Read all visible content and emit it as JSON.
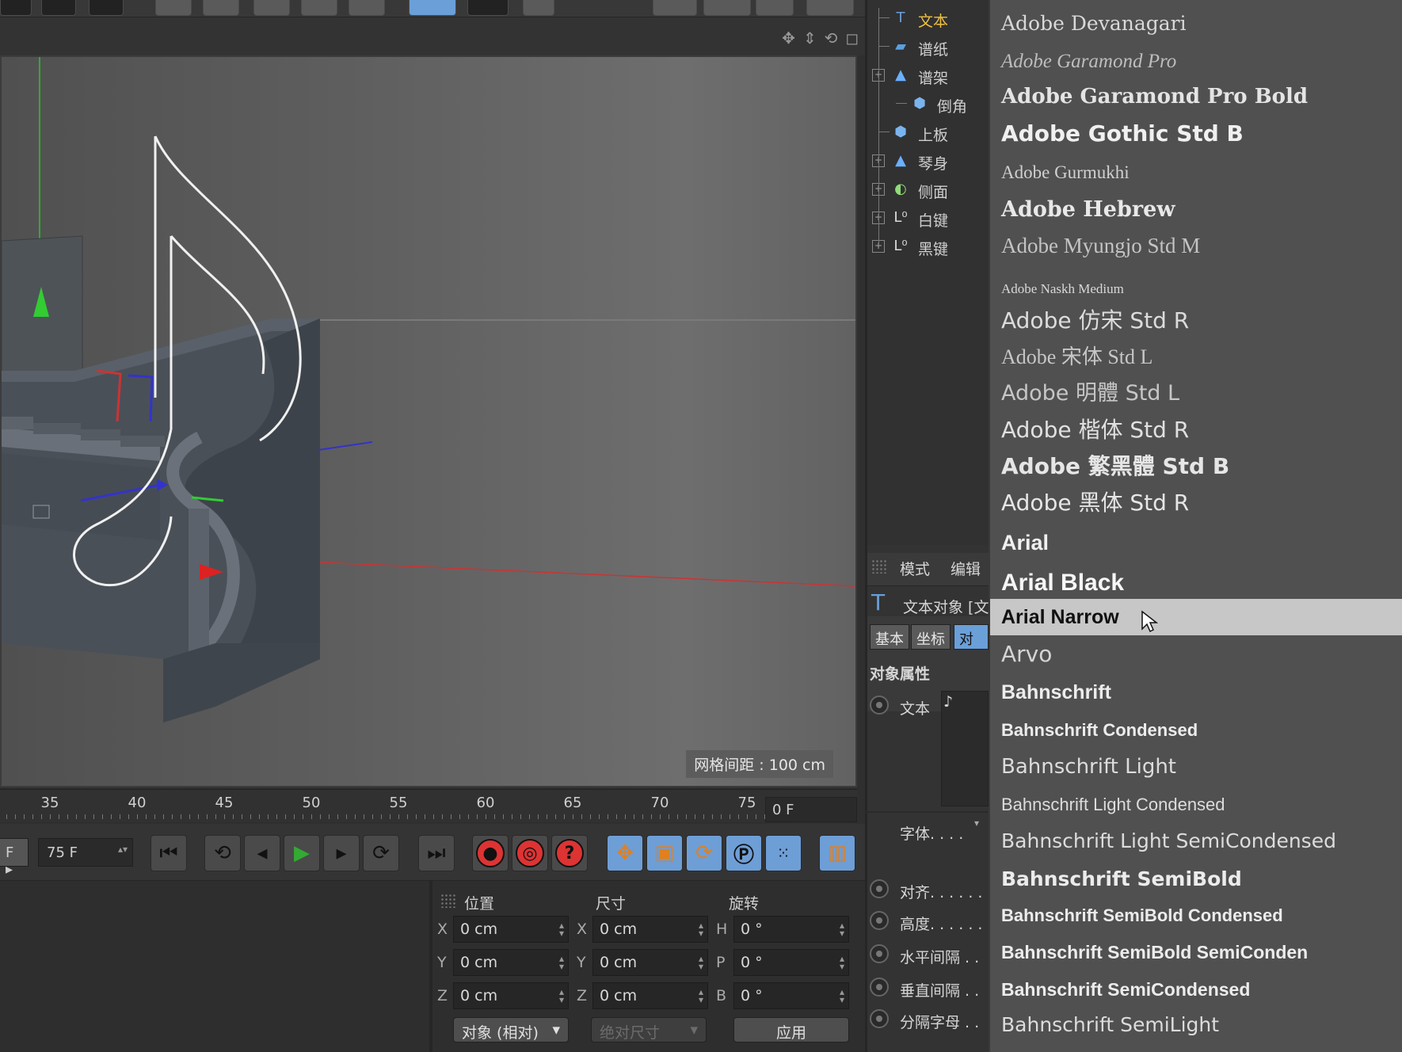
{
  "viewport": {
    "grid_spacing": "网格间距 : 100 cm"
  },
  "timeline": {
    "ticks": [
      "35",
      "40",
      "45",
      "50",
      "55",
      "60",
      "65",
      "70",
      "75"
    ],
    "current_frame": "0 F",
    "end_frame": "75 F"
  },
  "coordinates": {
    "headers": {
      "position": "位置",
      "size": "尺寸",
      "rotation": "旋转"
    },
    "rows": [
      {
        "axis": "X",
        "pos": "0 cm",
        "size_axis": "X",
        "size": "0 cm",
        "rot_axis": "H",
        "rot": "0 °"
      },
      {
        "axis": "Y",
        "pos": "0 cm",
        "size_axis": "Y",
        "size": "0 cm",
        "rot_axis": "P",
        "rot": "0 °"
      },
      {
        "axis": "Z",
        "pos": "0 cm",
        "size_axis": "Z",
        "size": "0 cm",
        "rot_axis": "B",
        "rot": "0 °"
      }
    ],
    "mode_dropdown": "对象 (相对)",
    "size_dropdown": "绝对尺寸",
    "apply_button": "应用"
  },
  "object_manager": {
    "items": [
      {
        "label": "文本",
        "icon": "text-icon",
        "highlight": true
      },
      {
        "label": "谱纸",
        "icon": "plane-icon"
      },
      {
        "label": "谱架",
        "icon": "null-icon"
      },
      {
        "label": "倒角",
        "icon": "cube-icon"
      },
      {
        "label": "上板",
        "icon": "cube-icon"
      },
      {
        "label": "琴身",
        "icon": "null-icon"
      },
      {
        "label": "侧面",
        "icon": "sphere-icon"
      },
      {
        "label": "白键",
        "icon": "cloner-icon"
      },
      {
        "label": "黑键",
        "icon": "cloner-icon"
      }
    ]
  },
  "attributes": {
    "menu": {
      "mode": "模式",
      "edit": "编辑"
    },
    "object_title": "文本对象 [文",
    "tabs": [
      "基本",
      "坐标",
      "对象"
    ],
    "section": "对象属性",
    "text_label": "文本",
    "text_value": "♪",
    "font_label": "字体. . . .",
    "params": [
      "对齐. . . . . .",
      "高度. . . . . .",
      "水平间隔 . .",
      "垂直间隔 . .",
      "分隔字母 . ."
    ]
  },
  "font_list": {
    "selected": "Arial Narrow",
    "items": [
      "Adobe Devanagari",
      "Adobe Garamond Pro",
      "Adobe Garamond Pro Bold",
      "Adobe Gothic Std B",
      "Adobe Gurmukhi",
      "Adobe Hebrew",
      "Adobe Myungjo Std M",
      "Adobe Naskh Medium",
      "Adobe 仿宋 Std R",
      "Adobe 宋体 Std L",
      "Adobe 明體 Std L",
      "Adobe 楷体 Std R",
      "Adobe 繁黑體 Std B",
      "Adobe 黑体 Std R",
      "Arial",
      "Arial Black",
      "Arial Narrow",
      "Arvo",
      "Bahnschrift",
      "Bahnschrift Condensed",
      "Bahnschrift Light",
      "Bahnschrift Light Condensed",
      "Bahnschrift Light SemiCondensed",
      "Bahnschrift SemiBold",
      "Bahnschrift SemiBold Condensed",
      "Bahnschrift SemiBold SemiConden",
      "Bahnschrift SemiCondensed",
      "Bahnschrift SemiLight"
    ]
  },
  "colors": {
    "accent_blue": "#6a9fd8",
    "highlight_text": "#f0c040",
    "selection": "#c7c7c7"
  }
}
